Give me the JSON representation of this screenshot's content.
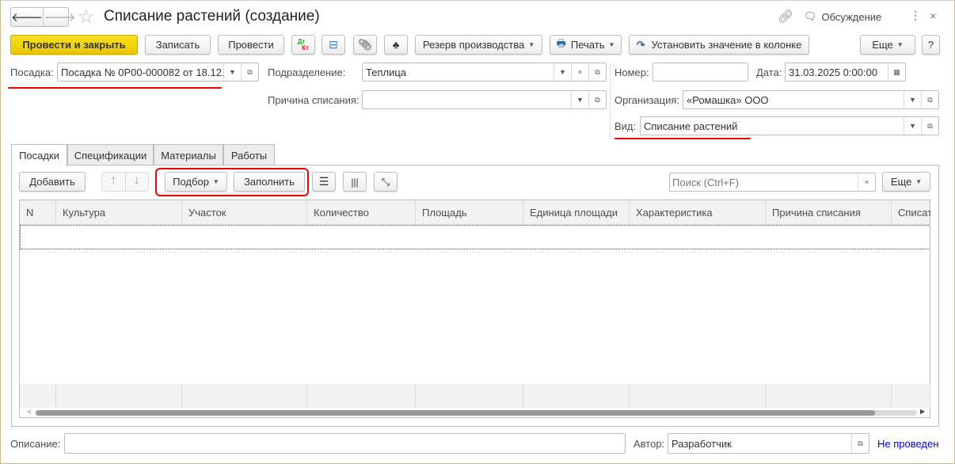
{
  "title": "Списание растений (создание)",
  "header": {
    "discussion": "Обсуждение"
  },
  "toolbar": {
    "post_close": "Провести и закрыть",
    "save": "Записать",
    "post": "Провести",
    "dtkt_dt": "Дт",
    "dtkt_kt": "Кт",
    "reserve": "Резерв производства",
    "print": "Печать",
    "set_value": "Установить значение в колонке",
    "more": "Еще",
    "help": "?"
  },
  "form": {
    "posadka_label": "Посадка:",
    "posadka_value": "Посадка № 0Р00-000082 от 18.12.",
    "division_label": "Подразделение:",
    "division_value": "Теплица",
    "reason_label": "Причина списания:",
    "reason_value": "",
    "number_label": "Номер:",
    "number_value": "",
    "date_label": "Дата:",
    "date_value": "31.03.2025  0:00:00",
    "org_label": "Организация:",
    "org_value": "«Ромашка» ООО",
    "kind_label": "Вид:",
    "kind_value": "Списание растений"
  },
  "tabs": [
    "Посадки",
    "Спецификации",
    "Материалы",
    "Работы"
  ],
  "table_toolbar": {
    "add": "Добавить",
    "pick": "Подбор",
    "fill": "Заполнить",
    "search_placeholder": "Поиск (Ctrl+F)",
    "more": "Еще"
  },
  "columns": [
    "N",
    "Культура",
    "Участок",
    "Количество",
    "Площадь",
    "Единица площади",
    "Характеристика",
    "Причина списания",
    "Списат"
  ],
  "footer": {
    "desc_label": "Описание:",
    "desc_value": "",
    "author_label": "Автор:",
    "author_value": "Разработчик",
    "status": "Не проведен"
  },
  "colors": {
    "accent": "#f2d400",
    "highlight": "#e00000",
    "link": "#0000ee"
  }
}
